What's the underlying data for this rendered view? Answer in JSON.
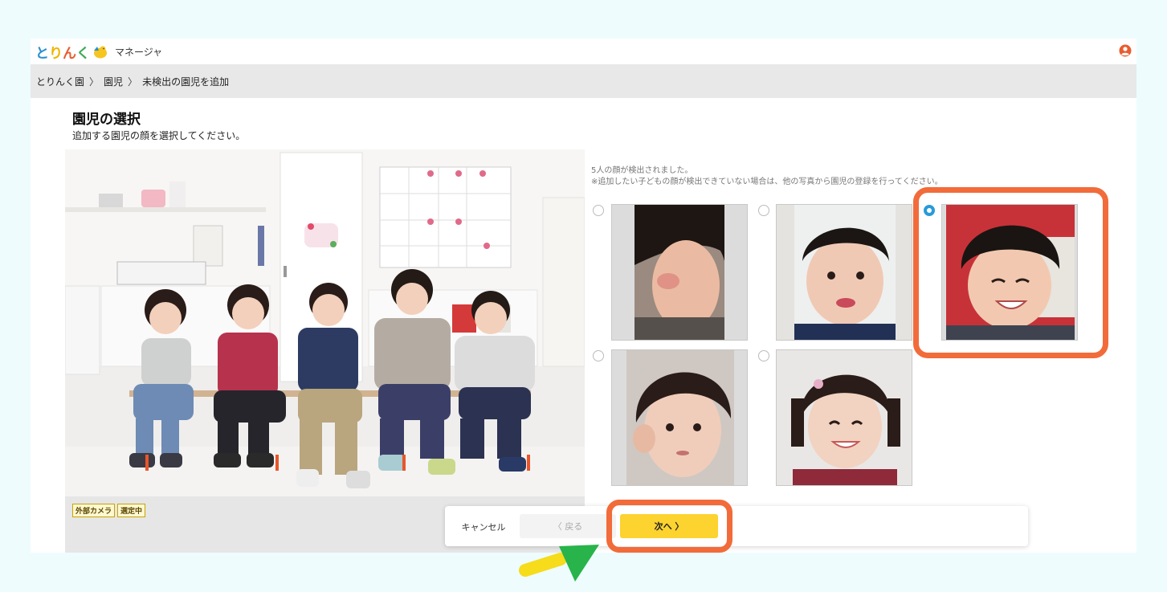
{
  "app": {
    "logo_text": [
      "と",
      "り",
      "ん",
      "く"
    ],
    "logo_subtitle": "マネージャ",
    "user_icon": "user-circle-icon"
  },
  "breadcrumb": {
    "items": [
      "とりんく園",
      "園児",
      "未検出の園児を追加"
    ],
    "separator": "〉"
  },
  "page": {
    "title": "園児の選択",
    "subtitle": "追加する園児の顔を選択してください。"
  },
  "photo": {
    "tags": [
      "外部カメラ",
      "選定中"
    ]
  },
  "detection": {
    "count_text": "5人の顔が検出されました。",
    "note_text": "※追加したい子どもの顔が検出できていない場合は、他の写真から園児の登録を行ってください。"
  },
  "faces": [
    {
      "id": "face-1",
      "selected": false
    },
    {
      "id": "face-2",
      "selected": false
    },
    {
      "id": "face-3",
      "selected": true
    },
    {
      "id": "face-4",
      "selected": false
    },
    {
      "id": "face-5",
      "selected": false
    }
  ],
  "footer": {
    "cancel_label": "キャンセル",
    "back_label": "〈  戻る",
    "next_label": "次へ  〉"
  },
  "colors": {
    "accent_yellow": "#fcd32f",
    "highlight_orange": "#f26b3a",
    "radio_blue": "#2a9ad8",
    "breadcrumb_bg": "#e8e8e8",
    "page_bg": "#eefcfd"
  }
}
